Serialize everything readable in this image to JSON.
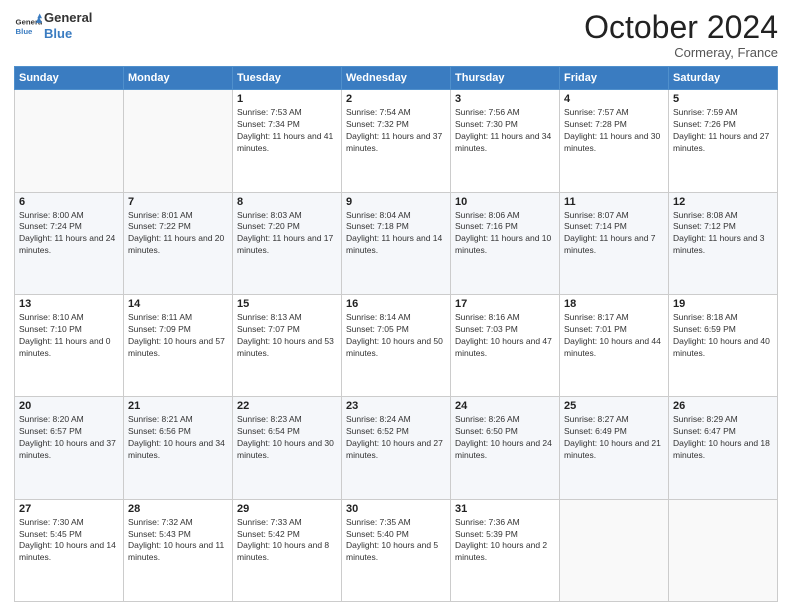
{
  "header": {
    "logo_line1": "General",
    "logo_line2": "Blue",
    "month": "October 2024",
    "location": "Cormeray, France"
  },
  "weekdays": [
    "Sunday",
    "Monday",
    "Tuesday",
    "Wednesday",
    "Thursday",
    "Friday",
    "Saturday"
  ],
  "weeks": [
    [
      {
        "day": "",
        "info": ""
      },
      {
        "day": "",
        "info": ""
      },
      {
        "day": "1",
        "info": "Sunrise: 7:53 AM\nSunset: 7:34 PM\nDaylight: 11 hours and 41 minutes."
      },
      {
        "day": "2",
        "info": "Sunrise: 7:54 AM\nSunset: 7:32 PM\nDaylight: 11 hours and 37 minutes."
      },
      {
        "day": "3",
        "info": "Sunrise: 7:56 AM\nSunset: 7:30 PM\nDaylight: 11 hours and 34 minutes."
      },
      {
        "day": "4",
        "info": "Sunrise: 7:57 AM\nSunset: 7:28 PM\nDaylight: 11 hours and 30 minutes."
      },
      {
        "day": "5",
        "info": "Sunrise: 7:59 AM\nSunset: 7:26 PM\nDaylight: 11 hours and 27 minutes."
      }
    ],
    [
      {
        "day": "6",
        "info": "Sunrise: 8:00 AM\nSunset: 7:24 PM\nDaylight: 11 hours and 24 minutes."
      },
      {
        "day": "7",
        "info": "Sunrise: 8:01 AM\nSunset: 7:22 PM\nDaylight: 11 hours and 20 minutes."
      },
      {
        "day": "8",
        "info": "Sunrise: 8:03 AM\nSunset: 7:20 PM\nDaylight: 11 hours and 17 minutes."
      },
      {
        "day": "9",
        "info": "Sunrise: 8:04 AM\nSunset: 7:18 PM\nDaylight: 11 hours and 14 minutes."
      },
      {
        "day": "10",
        "info": "Sunrise: 8:06 AM\nSunset: 7:16 PM\nDaylight: 11 hours and 10 minutes."
      },
      {
        "day": "11",
        "info": "Sunrise: 8:07 AM\nSunset: 7:14 PM\nDaylight: 11 hours and 7 minutes."
      },
      {
        "day": "12",
        "info": "Sunrise: 8:08 AM\nSunset: 7:12 PM\nDaylight: 11 hours and 3 minutes."
      }
    ],
    [
      {
        "day": "13",
        "info": "Sunrise: 8:10 AM\nSunset: 7:10 PM\nDaylight: 11 hours and 0 minutes."
      },
      {
        "day": "14",
        "info": "Sunrise: 8:11 AM\nSunset: 7:09 PM\nDaylight: 10 hours and 57 minutes."
      },
      {
        "day": "15",
        "info": "Sunrise: 8:13 AM\nSunset: 7:07 PM\nDaylight: 10 hours and 53 minutes."
      },
      {
        "day": "16",
        "info": "Sunrise: 8:14 AM\nSunset: 7:05 PM\nDaylight: 10 hours and 50 minutes."
      },
      {
        "day": "17",
        "info": "Sunrise: 8:16 AM\nSunset: 7:03 PM\nDaylight: 10 hours and 47 minutes."
      },
      {
        "day": "18",
        "info": "Sunrise: 8:17 AM\nSunset: 7:01 PM\nDaylight: 10 hours and 44 minutes."
      },
      {
        "day": "19",
        "info": "Sunrise: 8:18 AM\nSunset: 6:59 PM\nDaylight: 10 hours and 40 minutes."
      }
    ],
    [
      {
        "day": "20",
        "info": "Sunrise: 8:20 AM\nSunset: 6:57 PM\nDaylight: 10 hours and 37 minutes."
      },
      {
        "day": "21",
        "info": "Sunrise: 8:21 AM\nSunset: 6:56 PM\nDaylight: 10 hours and 34 minutes."
      },
      {
        "day": "22",
        "info": "Sunrise: 8:23 AM\nSunset: 6:54 PM\nDaylight: 10 hours and 30 minutes."
      },
      {
        "day": "23",
        "info": "Sunrise: 8:24 AM\nSunset: 6:52 PM\nDaylight: 10 hours and 27 minutes."
      },
      {
        "day": "24",
        "info": "Sunrise: 8:26 AM\nSunset: 6:50 PM\nDaylight: 10 hours and 24 minutes."
      },
      {
        "day": "25",
        "info": "Sunrise: 8:27 AM\nSunset: 6:49 PM\nDaylight: 10 hours and 21 minutes."
      },
      {
        "day": "26",
        "info": "Sunrise: 8:29 AM\nSunset: 6:47 PM\nDaylight: 10 hours and 18 minutes."
      }
    ],
    [
      {
        "day": "27",
        "info": "Sunrise: 7:30 AM\nSunset: 5:45 PM\nDaylight: 10 hours and 14 minutes."
      },
      {
        "day": "28",
        "info": "Sunrise: 7:32 AM\nSunset: 5:43 PM\nDaylight: 10 hours and 11 minutes."
      },
      {
        "day": "29",
        "info": "Sunrise: 7:33 AM\nSunset: 5:42 PM\nDaylight: 10 hours and 8 minutes."
      },
      {
        "day": "30",
        "info": "Sunrise: 7:35 AM\nSunset: 5:40 PM\nDaylight: 10 hours and 5 minutes."
      },
      {
        "day": "31",
        "info": "Sunrise: 7:36 AM\nSunset: 5:39 PM\nDaylight: 10 hours and 2 minutes."
      },
      {
        "day": "",
        "info": ""
      },
      {
        "day": "",
        "info": ""
      }
    ]
  ]
}
